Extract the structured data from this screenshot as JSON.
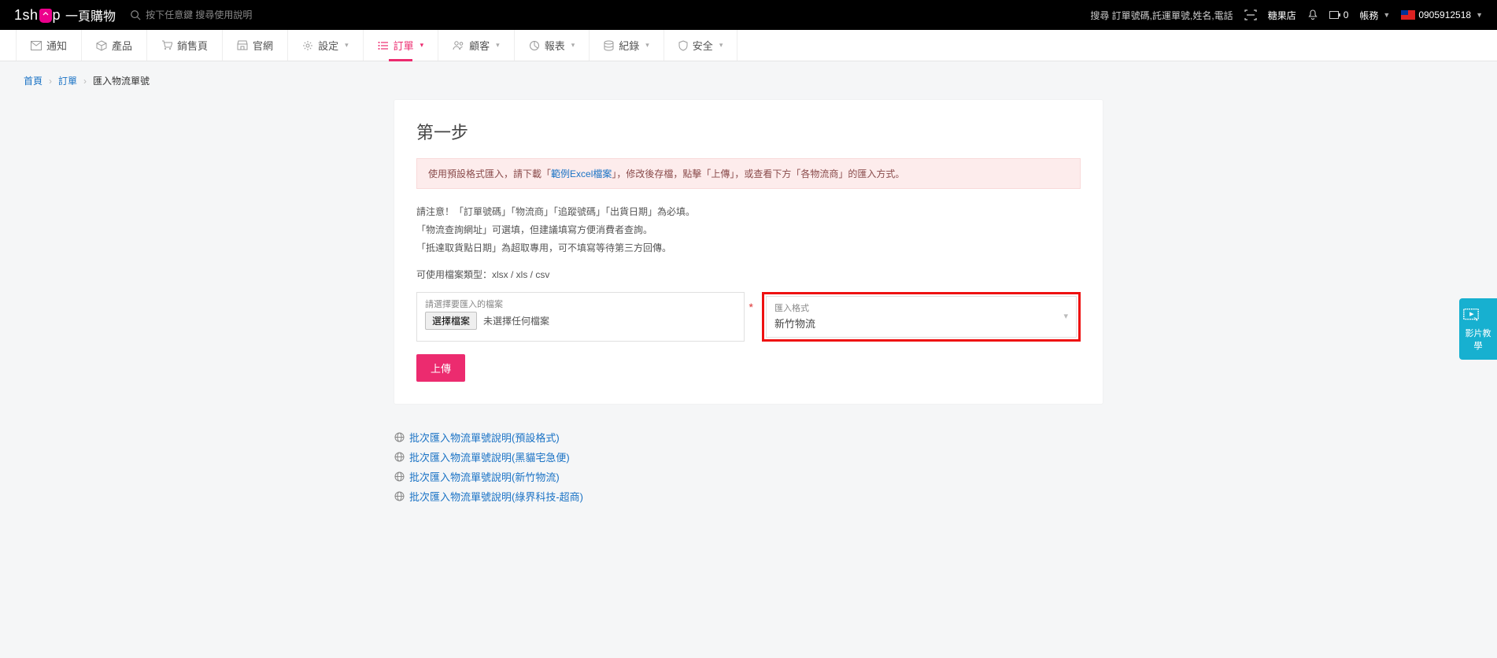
{
  "header": {
    "logo_en_pre": "1sh",
    "logo_en_post": "p",
    "logo_cn": "一頁購物",
    "search_placeholder": "按下任意鍵 搜尋使用說明",
    "search_hint": "搜尋 訂單號碼,託運單號,姓名,電話",
    "shop_name": "糖果店",
    "badge_count": "0",
    "account_label": "帳務",
    "phone": "0905912518"
  },
  "nav": {
    "items": [
      {
        "label": "通知"
      },
      {
        "label": "產品"
      },
      {
        "label": "銷售頁"
      },
      {
        "label": "官網"
      },
      {
        "label": "設定"
      },
      {
        "label": "訂單"
      },
      {
        "label": "顧客"
      },
      {
        "label": "報表"
      },
      {
        "label": "紀錄"
      },
      {
        "label": "安全"
      }
    ]
  },
  "breadcrumb": {
    "home": "首頁",
    "orders": "訂單",
    "current": "匯入物流單號"
  },
  "step": {
    "title": "第一步",
    "alert_pre": "使用預設格式匯入，請下載「",
    "alert_link": "範例Excel檔案",
    "alert_post": "」，修改後存檔，點擊「上傳」，或查看下方「各物流商」的匯入方式。",
    "note_line1": "請注意！「訂單號碼」「物流商」「追蹤號碼」「出貨日期」為必填。",
    "note_line2": "「物流查詢網址」可選填，但建議填寫方便消費者查詢。",
    "note_line3": "「抵達取貨點日期」為超取專用，可不填寫等待第三方回傳。",
    "filetype": "可使用檔案類型：xlsx / xls / csv",
    "file_label": "請選擇要匯入的檔案",
    "file_button": "選擇檔案",
    "file_status": "未選擇任何檔案",
    "format_label": "匯入格式",
    "format_value": "新竹物流",
    "upload": "上傳"
  },
  "help": {
    "links": [
      "批次匯入物流單號說明(預設格式)",
      "批次匯入物流單號說明(黑貓宅急便)",
      "批次匯入物流單號說明(新竹物流)",
      "批次匯入物流單號說明(綠界科技-超商)"
    ]
  },
  "float": {
    "label": "影片教學"
  }
}
